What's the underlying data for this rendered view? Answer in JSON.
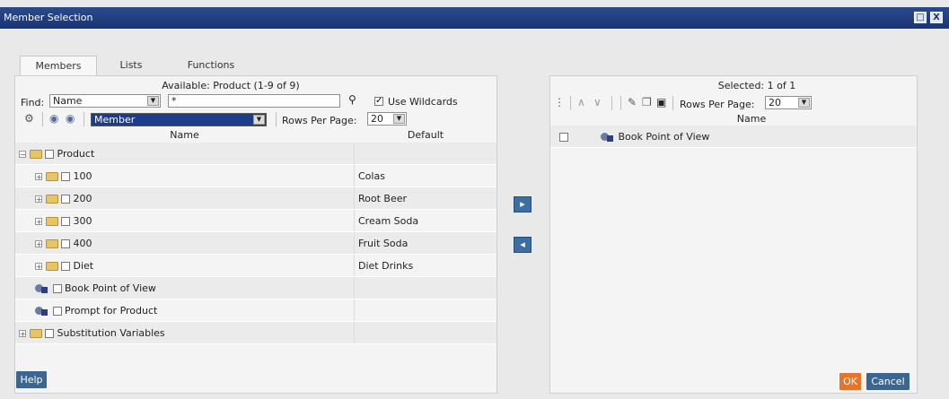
{
  "window": {
    "title": "Member Selection",
    "restore_glyph": "□",
    "close_glyph": "X"
  },
  "tabs": [
    {
      "label": "Members"
    },
    {
      "label": "Lists"
    },
    {
      "label": "Functions"
    }
  ],
  "available": {
    "header": "Available:  Product (1-9 of 9)",
    "find_label": "Find:",
    "find_by_value": "Name",
    "find_text_value": "*",
    "use_wildcards_label": "Use Wildcards",
    "use_wildcards_checked": true,
    "view_value": "Member",
    "rows_per_page_label": "Rows Per Page:",
    "rows_per_page_value": "20",
    "col_name": "Name",
    "col_default": "Default",
    "rows": [
      {
        "name": "Product",
        "default": "",
        "kind": "folder-open",
        "indent": 0
      },
      {
        "name": "100",
        "default": "Colas",
        "kind": "folder",
        "indent": 1
      },
      {
        "name": "200",
        "default": "Root Beer",
        "kind": "folder",
        "indent": 1
      },
      {
        "name": "300",
        "default": "Cream Soda",
        "kind": "folder",
        "indent": 1
      },
      {
        "name": "400",
        "default": "Fruit Soda",
        "kind": "folder",
        "indent": 1
      },
      {
        "name": "Diet",
        "default": "Diet Drinks",
        "kind": "folder",
        "indent": 1
      },
      {
        "name": "Book Point of View",
        "default": "",
        "kind": "member",
        "indent": 1
      },
      {
        "name": "Prompt for Product",
        "default": "",
        "kind": "member",
        "indent": 1
      },
      {
        "name": "Substitution Variables",
        "default": "",
        "kind": "folder",
        "indent": 0
      }
    ]
  },
  "move_buttons": {
    "add_glyph": "▸",
    "remove_glyph": "◂"
  },
  "selected": {
    "header": "Selected:  1 of 1",
    "rows_per_page_label": "Rows Per Page:",
    "rows_per_page_value": "20",
    "col_name": "Name",
    "rows": [
      {
        "name": "Book Point of View"
      }
    ]
  },
  "footer": {
    "help_label": "Help",
    "ok_label": "OK",
    "cancel_label": "Cancel"
  },
  "colors": {
    "title_bar": "#1a3474",
    "button_blue": "#3d6591",
    "ok_orange": "#e8742a"
  }
}
